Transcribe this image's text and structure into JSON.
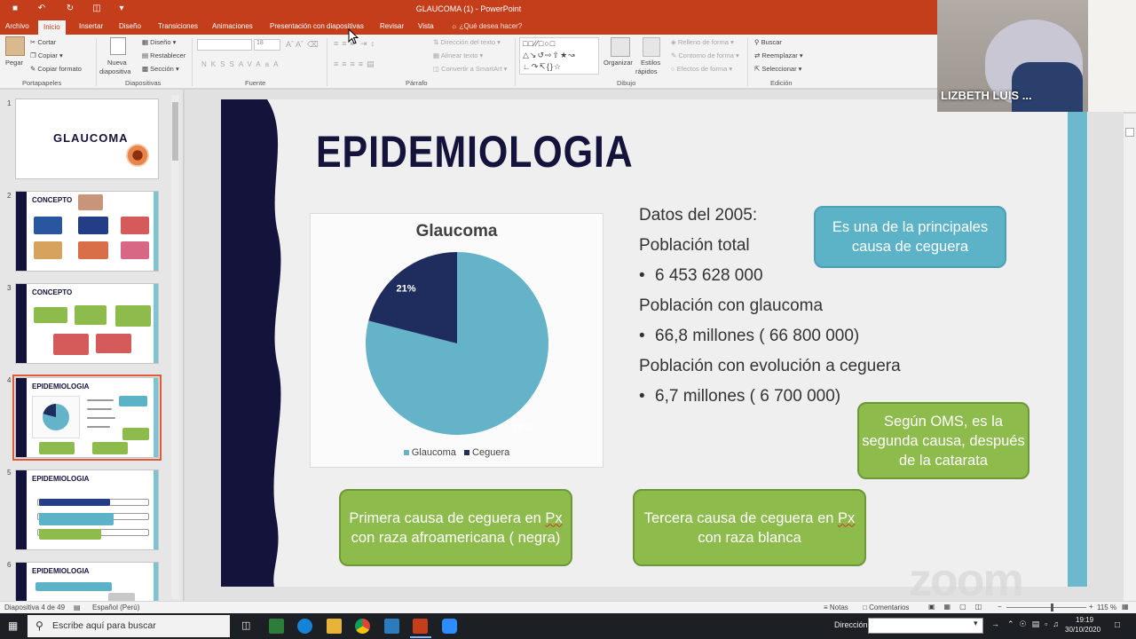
{
  "window": {
    "title": "GLAUCOMA (1) - PowerPoint"
  },
  "ribbon_tabs": [
    {
      "label": "Archivo",
      "active": false
    },
    {
      "label": "Inicio",
      "active": true
    },
    {
      "label": "Insertar",
      "active": false
    },
    {
      "label": "Diseño",
      "active": false
    },
    {
      "label": "Transiciones",
      "active": false
    },
    {
      "label": "Animaciones",
      "active": false
    },
    {
      "label": "Presentación con diapositivas",
      "active": false
    },
    {
      "label": "Revisar",
      "active": false
    },
    {
      "label": "Vista",
      "active": false
    }
  ],
  "tell_me": "¿Qué desea hacer?",
  "ribbon": {
    "clipboard": {
      "paste": "Pegar",
      "cut": "Cortar",
      "copy": "Copiar",
      "format_painter": "Copiar formato",
      "group": "Portapapeles"
    },
    "slides": {
      "new_slide_1": "Nueva",
      "new_slide_2": "diapositiva",
      "layout": "Diseño",
      "reset": "Restablecer",
      "section": "Sección",
      "group": "Diapositivas"
    },
    "font": {
      "size": "18",
      "group": "Fuente",
      "format_buttons": [
        "N",
        "K",
        "S",
        "S",
        "AV",
        "Aa",
        "A"
      ]
    },
    "paragraph": {
      "text_direction": "Dirección del texto",
      "align_text": "Alinear texto",
      "smartart": "Convertir a SmartArt",
      "group": "Párrafo"
    },
    "drawing": {
      "arrange": "Organizar",
      "quick_styles_1": "Estilos",
      "quick_styles_2": "rápidos",
      "shape_fill": "Relleno de forma",
      "shape_outline": "Contorno de forma",
      "shape_effects": "Efectos de forma",
      "group": "Dibujo"
    },
    "editing": {
      "find": "Buscar",
      "replace": "Reemplazar",
      "select": "Seleccionar",
      "group": "Edición"
    }
  },
  "thumbnails": [
    {
      "number": "1",
      "title": "GLAUCOMA"
    },
    {
      "number": "2",
      "title": "CONCEPTO"
    },
    {
      "number": "3",
      "title": "CONCEPTO"
    },
    {
      "number": "4",
      "title": "EPIDEMIOLOGIA"
    },
    {
      "number": "5",
      "title": "EPIDEMIOLOGIA"
    },
    {
      "number": "6",
      "title": "EPIDEMIOLOGIA"
    }
  ],
  "slide": {
    "title": "EPIDEMIOLOGIA",
    "info_lines": [
      "Datos del 2005:",
      "Población total",
      "6 453 628 000",
      "Población con glaucoma",
      "66,8 millones ( 66 800 000)",
      "Población con evolución a ceguera",
      "6,7 millones ( 6 700 000)"
    ],
    "callouts": {
      "blue": "Es una de la principales causa de ceguera",
      "oms": "Según OMS, es la segunda causa, después de la catarata",
      "primera_a": "Primera causa de ceguera en ",
      "primera_px": "Px",
      "primera_b": " con raza afroamericana ( negra)",
      "tercera_a": "Tercera causa de ceguera en ",
      "tercera_px": "Px",
      "tercera_b": " con raza blanca"
    }
  },
  "chart_data": {
    "type": "pie",
    "title": "Glaucoma",
    "categories": [
      "Glaucoma",
      "Ceguera"
    ],
    "values": [
      79,
      21
    ],
    "labels": [
      "79%",
      "21%"
    ],
    "colors": [
      "#65b3c9",
      "#1f2d5e"
    ],
    "legend": "bottom"
  },
  "status": {
    "slide_counter": "Diapositiva 4 de 49",
    "language": "Español (Perú)",
    "notes": "Notas",
    "comments": "Comentarios",
    "zoom": "115 %"
  },
  "taskbar": {
    "search_placeholder": "Escribe aquí para buscar",
    "address_label": "Dirección",
    "time": "19:19",
    "date": "30/10/2020"
  },
  "webcam": {
    "name": "LIZBETH LUIS ..."
  },
  "watermark": "zoom"
}
